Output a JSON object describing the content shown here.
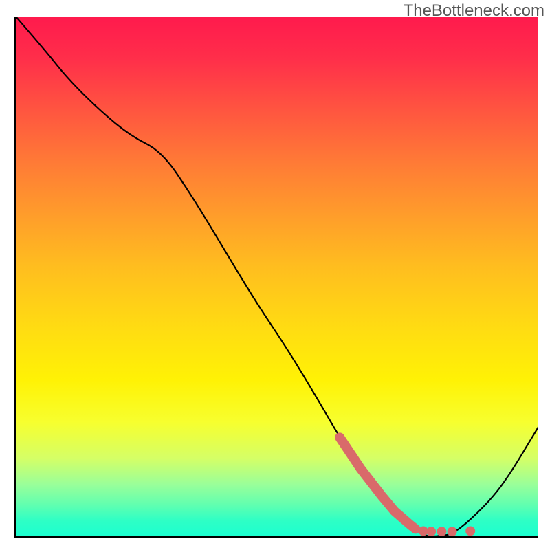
{
  "watermark": "TheBottleneck.com",
  "chart_data": {
    "type": "line",
    "title": "",
    "xlabel": "",
    "ylabel": "",
    "xlim": [
      0,
      100
    ],
    "ylim": [
      0,
      100
    ],
    "series": [
      {
        "name": "curve",
        "x": [
          0,
          6,
          10,
          16,
          22,
          28,
          34,
          40,
          46,
          52,
          58,
          62,
          66,
          70,
          74,
          78,
          81,
          84,
          90,
          94,
          100
        ],
        "y": [
          100,
          93,
          88,
          82,
          77,
          74,
          65,
          55,
          45,
          36,
          26,
          19,
          13,
          7.8,
          3.5,
          0,
          0,
          0.5,
          6,
          11,
          21
        ],
        "color": "#000000"
      }
    ],
    "highlight": {
      "name": "highlight-segment",
      "color": "#d96a6a",
      "points": [
        {
          "x": 62,
          "y": 19
        },
        {
          "x": 66,
          "y": 13
        },
        {
          "x": 70,
          "y": 7.8
        },
        {
          "x": 72.5,
          "y": 4.8
        },
        {
          "x": 74,
          "y": 3.5
        },
        {
          "x": 75.5,
          "y": 2.2
        },
        {
          "x": 76.5,
          "y": 1.4
        }
      ],
      "dots": [
        {
          "x": 78.0,
          "y": 1.0
        },
        {
          "x": 79.5,
          "y": 0.9
        },
        {
          "x": 81.5,
          "y": 0.9
        },
        {
          "x": 83.5,
          "y": 0.9
        },
        {
          "x": 87.0,
          "y": 1.0
        }
      ]
    }
  }
}
